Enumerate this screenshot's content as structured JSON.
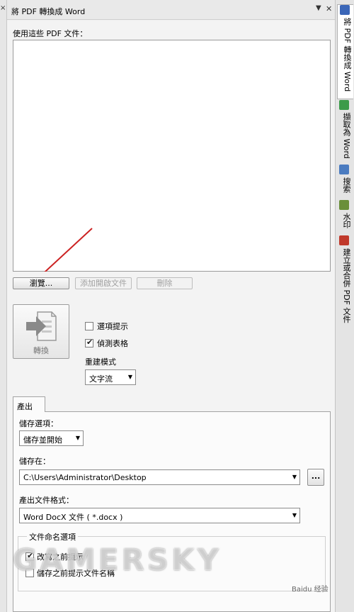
{
  "colors": {
    "panel": "#f3f3f3",
    "accent_arrow": "#cc2222"
  },
  "left_close_icon": "×",
  "window": {
    "title": "將 PDF 轉換成 Word",
    "menu_icon": "▼",
    "close_icon": "✕"
  },
  "files": {
    "label": "使用這些 PDF 文件："
  },
  "buttons": {
    "browse": "瀏覽...",
    "add_open": "添加開啟文件",
    "delete": "刪除",
    "convert": "轉換",
    "more": "..."
  },
  "options": {
    "page_hint": {
      "label": "選項提示",
      "checked": false
    },
    "detect_table": {
      "label": "偵測表格",
      "checked": true
    },
    "rebuild_label": "重建模式",
    "rebuild_value": "文字流"
  },
  "output": {
    "tab_label": "產出",
    "save_option_label": "儲存選項：",
    "save_option_value": "儲存並開始",
    "save_in_label": "儲存在：",
    "save_in_value": "C:\\Users\\Administrator\\Desktop",
    "format_label": "產出文件格式：",
    "format_value": "Word DocX 文件 ( *.docx )",
    "naming_title": "文件命名選項",
    "prompt_before": {
      "label": "改寫之前提示",
      "checked": true
    },
    "name_prompt": {
      "label": "儲存之前提示文件名稱",
      "checked": false
    }
  },
  "sidebar": {
    "tabs": [
      {
        "label": "將 PDF 轉換成 Word",
        "icon": "pdf-word-icon",
        "color": "#3a66b8"
      },
      {
        "label": "擷取為 Word",
        "icon": "capture-icon",
        "color": "#3c9b4a"
      },
      {
        "label": "搜索",
        "icon": "search-icon",
        "color": "#4a7bc0"
      },
      {
        "label": "水印",
        "icon": "watermark-icon",
        "color": "#6a8f3a"
      },
      {
        "label": "建立或合併 PDF 文件",
        "icon": "create-pdf-icon",
        "color": "#c0392b"
      }
    ]
  },
  "watermark_text": "GAMERSKY",
  "corner_mark": "Baidu 经验"
}
